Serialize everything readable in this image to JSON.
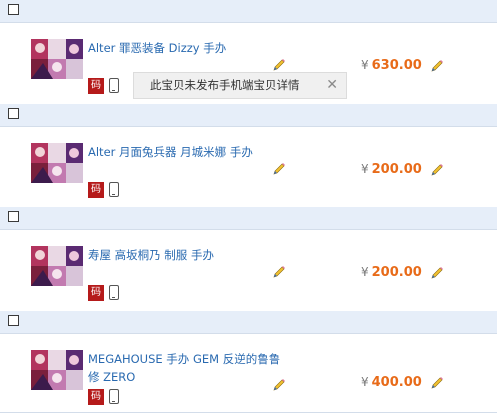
{
  "items": [
    {
      "title": "Alter 罪恶装备 Dizzy 手办",
      "tag": "码",
      "price": "630.00",
      "currency": "¥"
    },
    {
      "title": "Alter 月面兔兵器 月城米娜 手办",
      "tag": "码",
      "price": "200.00",
      "currency": "¥"
    },
    {
      "title": "寿屋 高坂桐乃 制服 手办",
      "tag": "码",
      "price": "200.00",
      "currency": "¥"
    },
    {
      "title": "MEGAHOUSE 手办 GEM 反逆的鲁鲁修 ZERO",
      "tag": "码",
      "price": "400.00",
      "currency": "¥"
    }
  ],
  "tooltip": {
    "text": "此宝贝未发布手机端宝贝详情",
    "close": "✕"
  },
  "colors": {
    "header_bg": "#e6eef9",
    "price": "#e86b19",
    "title": "#2a6ab0",
    "tag_bg": "#b51a1a"
  }
}
